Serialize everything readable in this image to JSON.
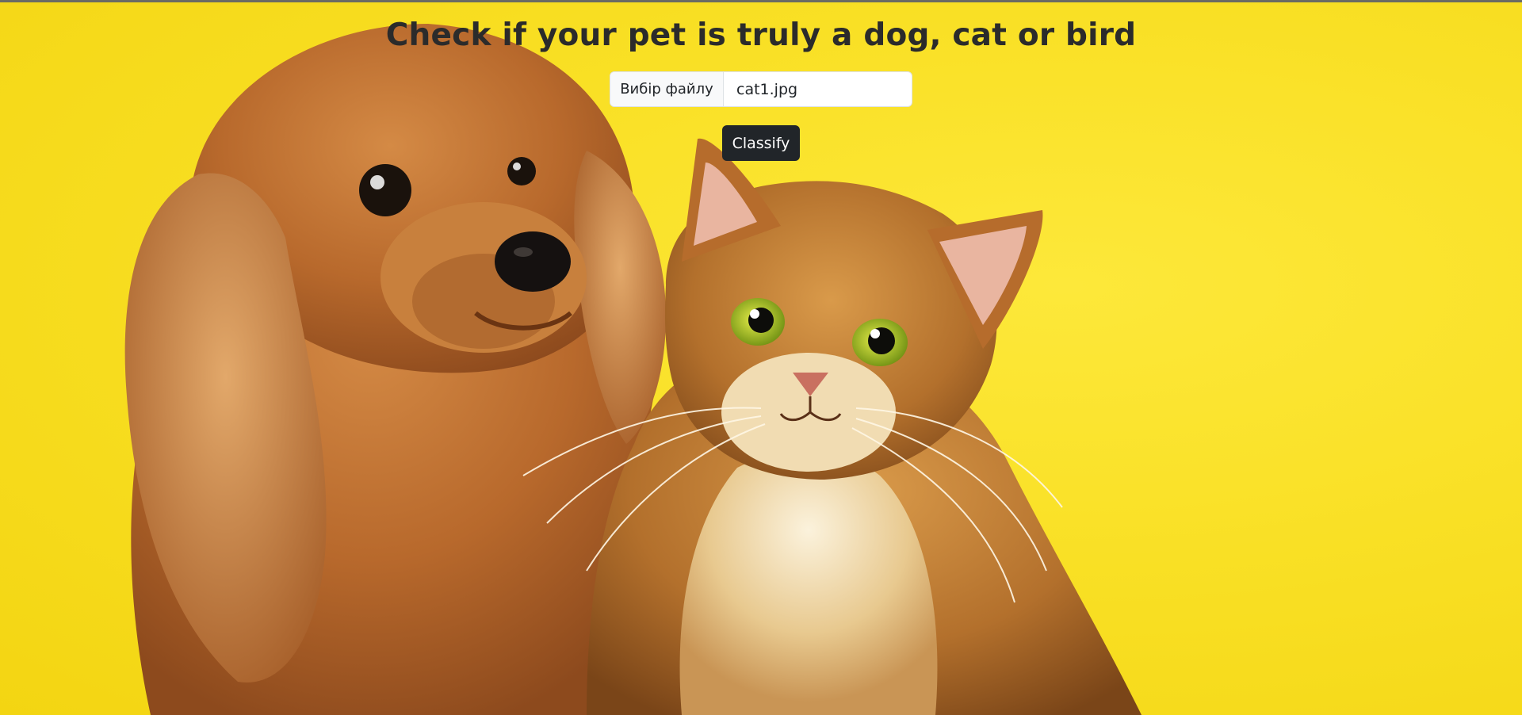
{
  "page": {
    "title": "Check if your pet is truly a dog, cat or bird"
  },
  "upload": {
    "choose_label": "Вибір файлу",
    "file_name": "cat1.jpg"
  },
  "actions": {
    "classify_label": "Classify"
  },
  "hero": {
    "icon": "dog-and-cat-photo"
  },
  "colors": {
    "background": "#f9e025",
    "button_dark": "#212529",
    "title_text": "#2b2b2b"
  }
}
